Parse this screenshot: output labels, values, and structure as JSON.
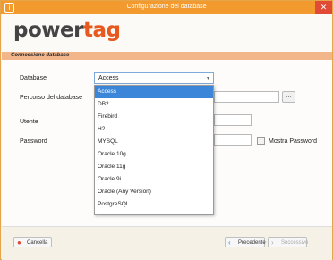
{
  "window": {
    "title": "Configurazione del database",
    "app_icon": "i",
    "close_glyph": "✕"
  },
  "logo": {
    "part1": "power",
    "part2": "tag"
  },
  "section": {
    "title": "Connessione database"
  },
  "form": {
    "database_label": "Database",
    "database_value": "Access",
    "percorso_label": "Percorso del database",
    "browse_label": "...",
    "utente_label": "Utente",
    "password_label": "Password",
    "show_password_label": "Mostra Password"
  },
  "dropdown": {
    "options": [
      "Access",
      "DB2",
      "Firebird",
      "H2",
      "MYSQL",
      "Oracle 10g",
      "Oracle 11g",
      "Oracle 9i",
      "Oracle (Any Version)",
      "PostgreSQL"
    ],
    "selected_index": 0
  },
  "footer": {
    "cancel_label": "Cancella",
    "prev_label": "Precedente",
    "next_label": "Successivo"
  },
  "colors": {
    "accent": "#f29a2e",
    "close": "#e04a36",
    "logo_orange": "#e65a1f",
    "section": "#f2b68a",
    "selection": "#3b86d8"
  }
}
